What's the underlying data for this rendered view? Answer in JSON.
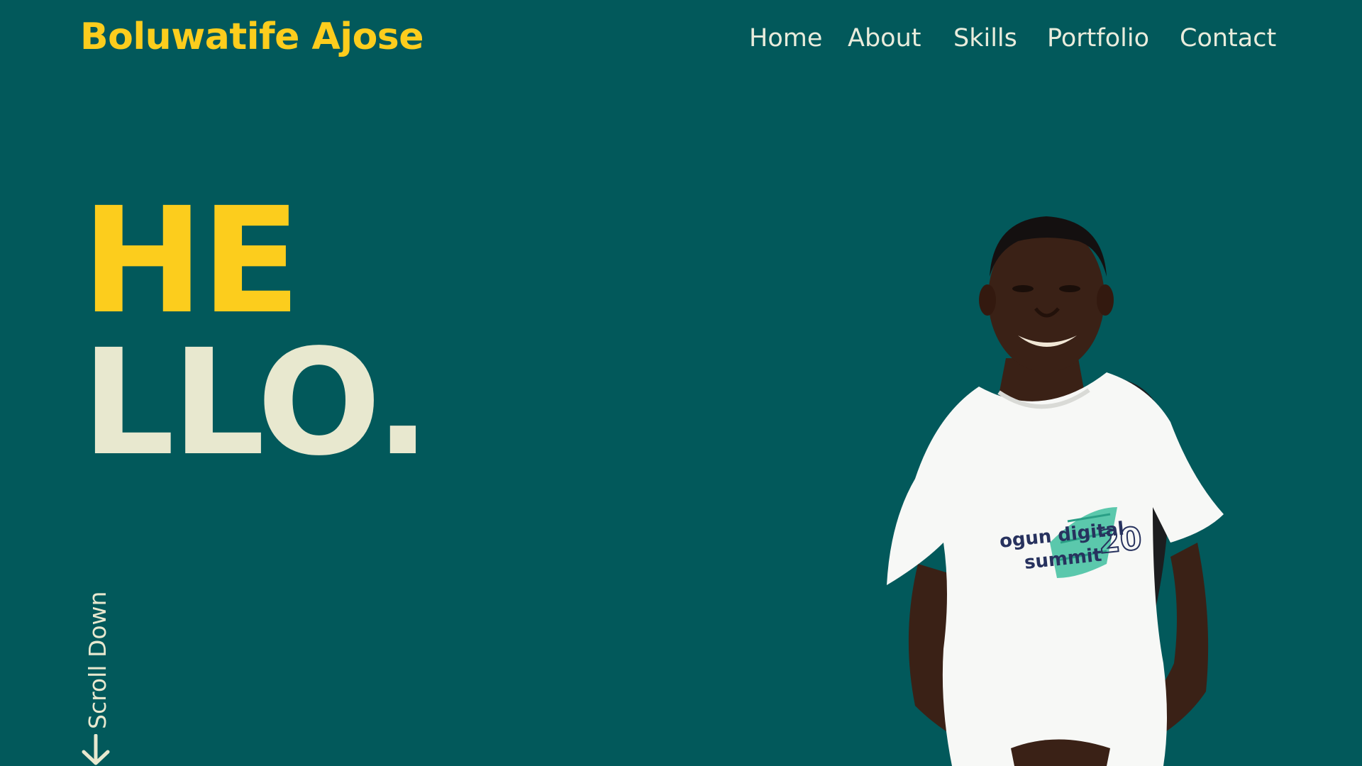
{
  "header": {
    "brand": "Boluwatife Ajose",
    "nav": [
      "Home",
      "About",
      "Skills",
      "Portfolio",
      "Contact"
    ]
  },
  "hero": {
    "line1": "HE",
    "line2": "LLO."
  },
  "scroll": {
    "label": "Scroll Down",
    "icon": "arrow-down-icon"
  },
  "portrait": {
    "shirt_line1": "ogun digital",
    "shirt_line2": "summit",
    "shirt_number": "20"
  },
  "colors": {
    "background": "#02595b",
    "accent": "#fccd1d",
    "light_text": "#e8e8cf",
    "nav_text": "#e9ecdc",
    "shirt": "#f7f8f6",
    "skin": "#3a2116",
    "bag_strap": "#1c1d1f",
    "shirt_print_teal": "#3fbf9f",
    "shirt_print_navy": "#27325e"
  }
}
